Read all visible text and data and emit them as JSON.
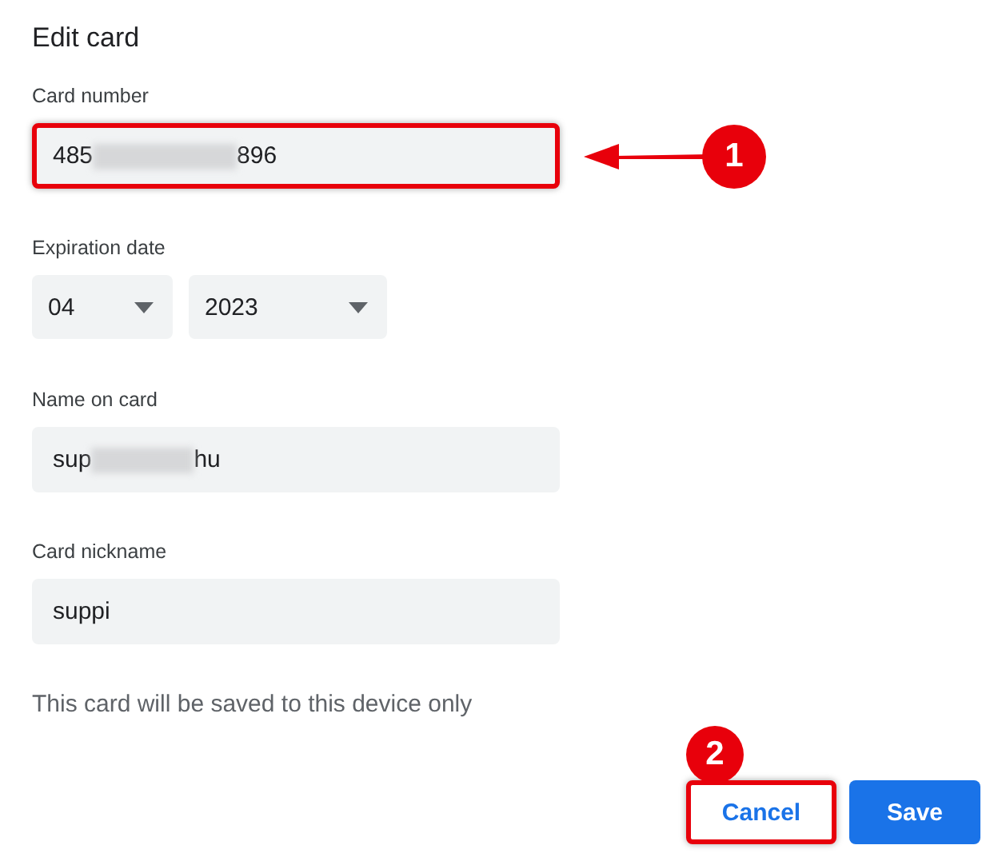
{
  "title": "Edit card",
  "fields": [
    {
      "kind": "masked",
      "label": "Card number",
      "value_start": "485",
      "value_end": "896",
      "highlighted": true,
      "callout": "1"
    },
    {
      "kind": "selects",
      "label": "Expiration date",
      "month": "04",
      "year": "2023"
    },
    {
      "kind": "masked",
      "label": "Name on card",
      "value_start": "sup",
      "value_end": "hu",
      "highlighted": false
    },
    {
      "kind": "text",
      "label": "Card nickname",
      "value": "suppi"
    }
  ],
  "note": "This card will be saved to this device only",
  "buttons": [
    {
      "kind": "secondary",
      "label": "Cancel",
      "highlighted": true,
      "callout": "2"
    },
    {
      "kind": "primary",
      "label": "Save",
      "highlighted": false
    }
  ]
}
